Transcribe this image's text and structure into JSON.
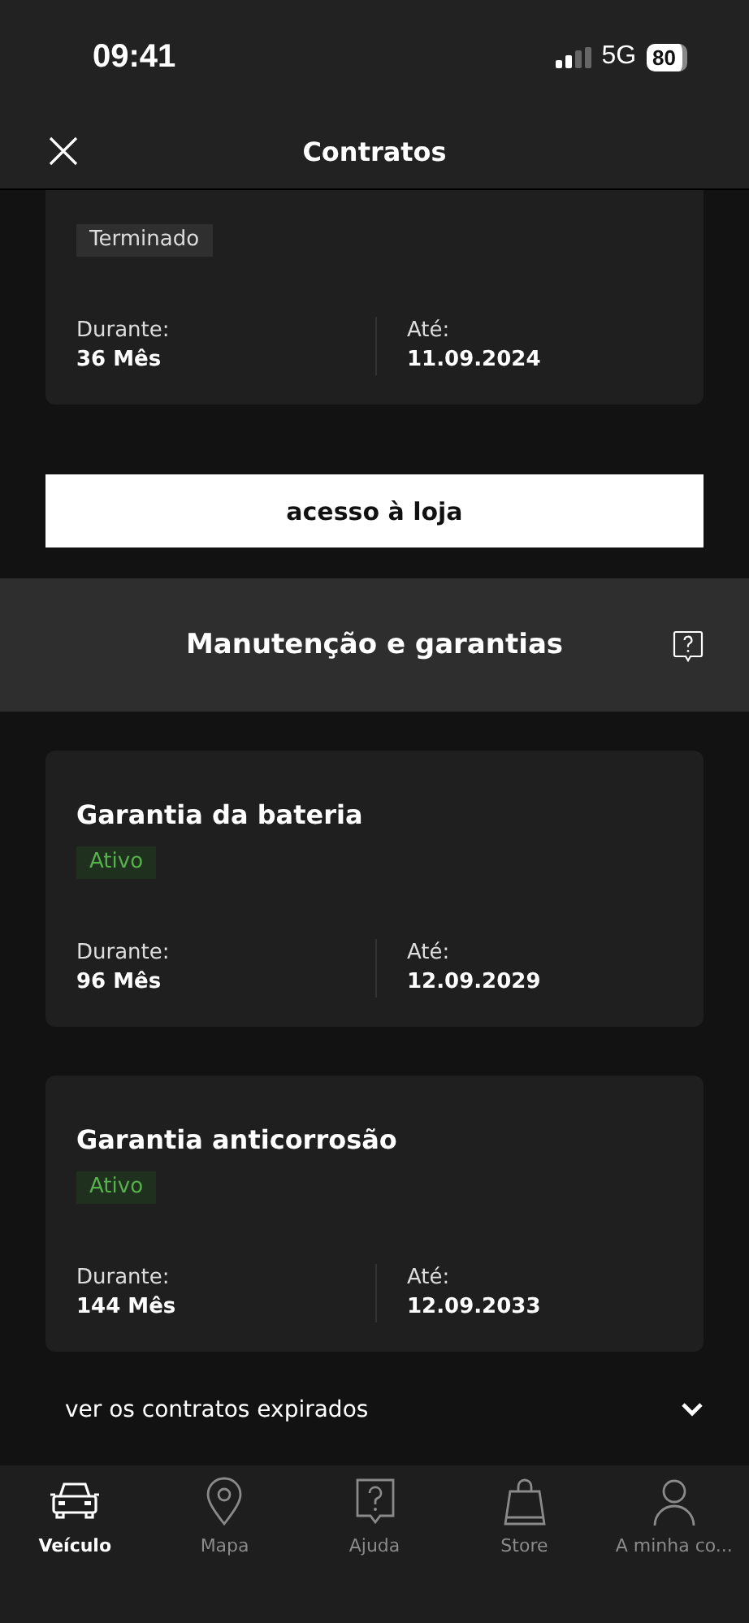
{
  "status_bar": {
    "time": "09:41",
    "network": "5G",
    "battery": "80"
  },
  "header": {
    "title": "Contratos"
  },
  "contracts_top": [
    {
      "status": {
        "label": "Terminado",
        "kind": "ended"
      },
      "duration_label": "Durante:",
      "duration": "36 Mês",
      "until_label": "Até:",
      "until": "11.09.2024"
    }
  ],
  "store_button": "acesso à loja",
  "section": {
    "title": "Manutenção e garantias"
  },
  "contracts": [
    {
      "title": "Garantia da bateria",
      "status": {
        "label": "Ativo",
        "kind": "active"
      },
      "duration_label": "Durante:",
      "duration": "96 Mês",
      "until_label": "Até:",
      "until": "12.09.2029"
    },
    {
      "title": "Garantia anticorrosão",
      "status": {
        "label": "Ativo",
        "kind": "active"
      },
      "duration_label": "Durante:",
      "duration": "144 Mês",
      "until_label": "Até:",
      "until": "12.09.2033"
    }
  ],
  "expired_link": {
    "label": "ver os contratos expirados",
    "expanded": false
  },
  "tab_bar": [
    {
      "label": "Veículo",
      "kind": "car",
      "selected": true
    },
    {
      "label": "Mapa",
      "kind": "pin",
      "selected": false
    },
    {
      "label": "Ajuda",
      "kind": "help",
      "selected": false
    },
    {
      "label": "Store",
      "kind": "bag",
      "selected": false
    },
    {
      "label": "A minha co...",
      "kind": "person",
      "selected": false
    }
  ]
}
